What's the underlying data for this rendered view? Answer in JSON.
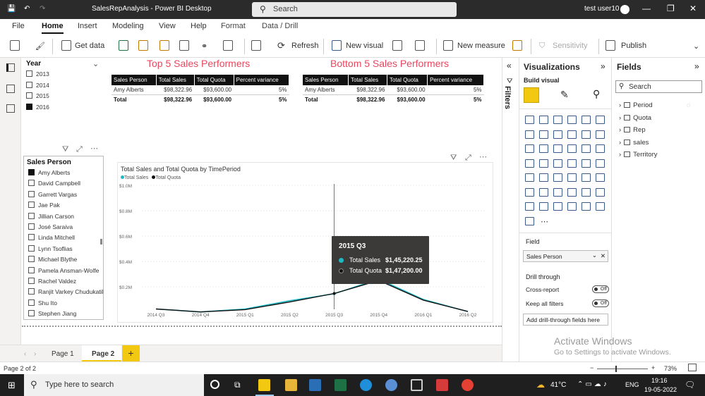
{
  "window": {
    "title": "SalesRepAnalysis - Power BI Desktop",
    "search_label": "Search",
    "user": "test user10"
  },
  "ribbon_tabs": [
    "File",
    "Home",
    "Insert",
    "Modeling",
    "View",
    "Help",
    "Format",
    "Data / Drill"
  ],
  "ribbon": {
    "get_data": "Get data",
    "refresh": "Refresh",
    "new_visual": "New visual",
    "new_measure": "New measure",
    "sensitivity": "Sensitivity",
    "publish": "Publish"
  },
  "year_slicer": {
    "title": "Year",
    "items": [
      {
        "label": "2013",
        "checked": false
      },
      {
        "label": "2014",
        "checked": false
      },
      {
        "label": "2015",
        "checked": false
      },
      {
        "label": "2016",
        "checked": true
      }
    ]
  },
  "top5": {
    "title": "Top 5 Sales Performers",
    "columns": [
      "Sales Person",
      "Total Sales",
      "Total Quota",
      "Percent variance"
    ],
    "rows": [
      [
        "Amy Alberts",
        "$98,322.96",
        "$93,600.00",
        "5%"
      ]
    ],
    "total": [
      "Total",
      "$98,322.96",
      "$93,600.00",
      "5%"
    ]
  },
  "bottom5": {
    "title": "Bottom 5 Sales Performers",
    "columns": [
      "Sales Person",
      "Total Sales",
      "Total Quota",
      "Percent variance"
    ],
    "rows": [
      [
        "Amy Alberts",
        "$98,322.96",
        "$93,600.00",
        "5%"
      ]
    ],
    "total": [
      "Total",
      "$98,322.96",
      "$93,600.00",
      "5%"
    ]
  },
  "person_slicer": {
    "title": "Sales Person",
    "items": [
      {
        "label": "Amy Alberts",
        "checked": true
      },
      {
        "label": "David Campbell",
        "checked": false
      },
      {
        "label": "Garrett Vargas",
        "checked": false
      },
      {
        "label": "Jae Pak",
        "checked": false
      },
      {
        "label": "Jillian Carson",
        "checked": false
      },
      {
        "label": "José Saraiva",
        "checked": false
      },
      {
        "label": "Linda Mitchell",
        "checked": false
      },
      {
        "label": "Lynn Tsoflias",
        "checked": false
      },
      {
        "label": "Michael Blythe",
        "checked": false
      },
      {
        "label": "Pamela Ansman-Wolfe",
        "checked": false
      },
      {
        "label": "Rachel Valdez",
        "checked": false
      },
      {
        "label": "Ranjit Varkey Chudukatil",
        "checked": false
      },
      {
        "label": "Shu Ito",
        "checked": false
      },
      {
        "label": "Stephen Jiang",
        "checked": false
      }
    ]
  },
  "chart_data": {
    "type": "line",
    "title": "Total Sales and Total Quota by TimePeriod",
    "categories": [
      "2014 Q3",
      "2014 Q4",
      "2015 Q1",
      "2015 Q2",
      "2015 Q3",
      "2015 Q4",
      "2016 Q1",
      "2016 Q2"
    ],
    "series": [
      {
        "name": "Total Sales",
        "color": "#1fb8c4",
        "values": [
          25000,
          2000,
          25000,
          90000,
          145220.25,
          260000,
          100000,
          5000
        ]
      },
      {
        "name": "Total Quota",
        "color": "#111111",
        "values": [
          25000,
          2000,
          20000,
          80000,
          147200,
          250000,
          95000,
          5000
        ]
      }
    ],
    "y_ticks": [
      "$0.2M",
      "$0.4M",
      "$0.6M",
      "$0.8M",
      "$1.0M"
    ],
    "ylim": [
      0,
      1000000
    ],
    "grid": true,
    "legend": "top-left",
    "tooltip": {
      "header": "2015 Q3",
      "rows": [
        {
          "label": "Total Sales",
          "value": "$1,45,220.25",
          "color": "#1fb8c4"
        },
        {
          "label": "Total Quota",
          "value": "$1,47,200.00",
          "color": "#111111"
        }
      ]
    }
  },
  "pages": {
    "items": [
      "Page 1",
      "Page 2"
    ],
    "active": "Page 2",
    "add_label": "+"
  },
  "filters_label": "Filters",
  "visualizations": {
    "title": "Visualizations",
    "build_visual": "Build visual",
    "field_label": "Field",
    "field_value": "Sales Person",
    "drill_through": "Drill through",
    "cross_report": "Cross-report",
    "keep_all_filters": "Keep all filters",
    "toggle_off": "Off",
    "add_fields": "Add drill-through fields here"
  },
  "fields": {
    "title": "Fields",
    "search_placeholder": "Search",
    "tables": [
      "Period",
      "Quota",
      "Rep",
      "sales",
      "Territory"
    ]
  },
  "status": {
    "page": "Page 2 of 2",
    "zoom": "73%"
  },
  "watermark": {
    "line1": "Activate Windows",
    "line2": "Go to Settings to activate Windows."
  },
  "taskbar": {
    "search_placeholder": "Type here to search",
    "temperature": "41°C",
    "language": "ENG",
    "time": "19:16",
    "date": "19-05-2022"
  }
}
